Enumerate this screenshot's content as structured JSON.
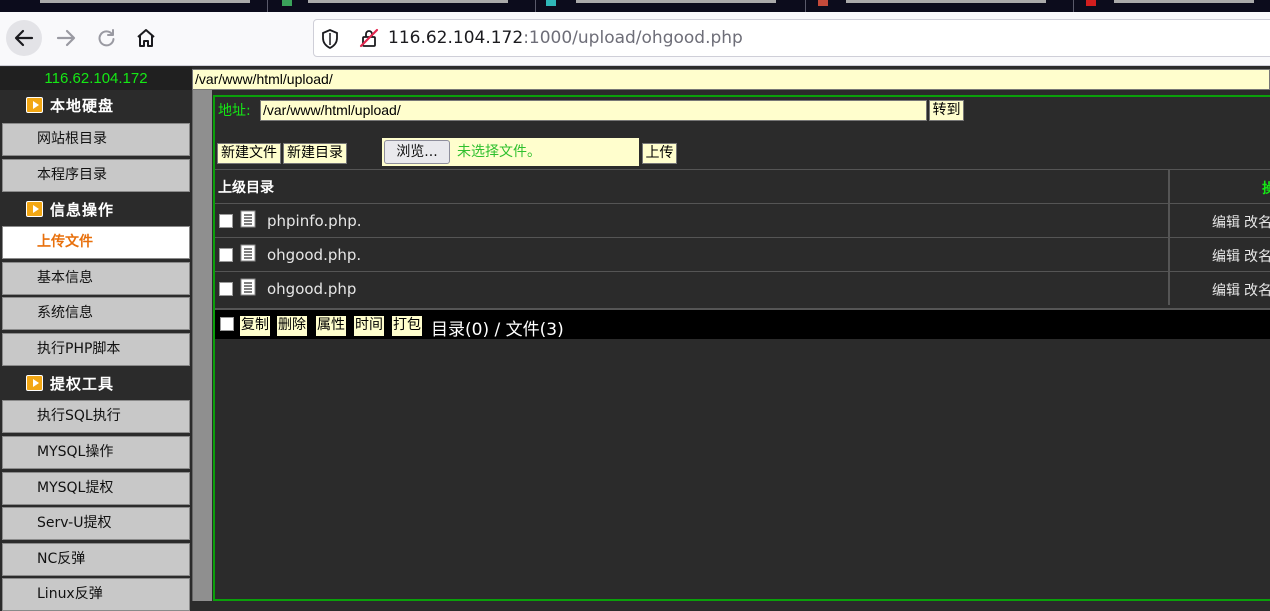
{
  "browser": {
    "url_host": "116.62.104.172",
    "url_rest": ":1000/upload/ohgood.php"
  },
  "page": {
    "host_ip": "116.62.104.172",
    "top_path": "/var/www/html/upload/"
  },
  "sidebar": {
    "sections": [
      {
        "title": "本地硬盘",
        "items": [
          "网站根目录",
          "本程序目录"
        ]
      },
      {
        "title": "信息操作",
        "items": [
          "上传文件",
          "基本信息",
          "系统信息",
          "执行PHP脚本"
        ]
      },
      {
        "title": "提权工具",
        "items": [
          "执行SQL执行",
          "MYSQL操作",
          "MYSQL提权",
          "Serv-U提权",
          "NC反弹",
          "Linux反弹"
        ]
      }
    ],
    "active_item": "上传文件"
  },
  "main": {
    "address_label": "地址:",
    "address_value": "/var/www/html/upload/",
    "goto_label": "转到",
    "new_file_label": "新建文件",
    "new_dir_label": "新建目录",
    "browse_label": "浏览...",
    "no_file_label": "未选择文件。",
    "upload_label": "上传",
    "table_header": {
      "name": "上级目录",
      "op": "操"
    },
    "files": [
      {
        "name": "phpinfo.php.",
        "ops": [
          "编辑",
          "改名"
        ]
      },
      {
        "name": "ohgood.php.",
        "ops": [
          "编辑",
          "改名"
        ]
      },
      {
        "name": "ohgood.php",
        "ops": [
          "编辑",
          "改名"
        ]
      }
    ],
    "actions": [
      "复制",
      "删除",
      "属性",
      "时间",
      "打包"
    ],
    "summary": "目录(0) / 文件(3)"
  }
}
